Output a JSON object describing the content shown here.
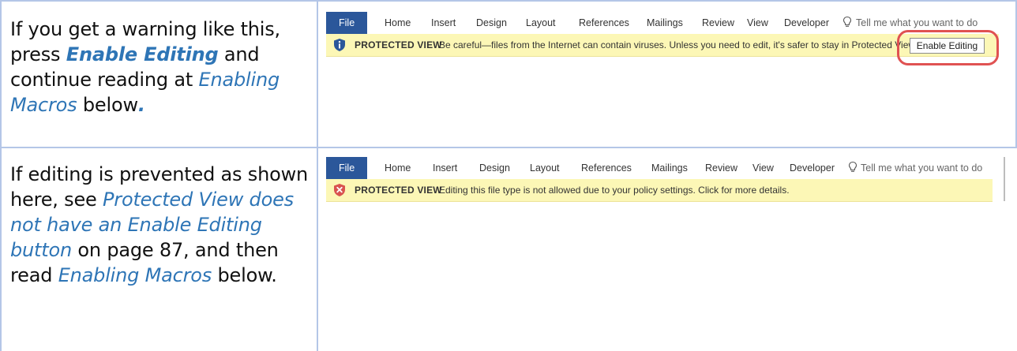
{
  "rows": [
    {
      "instruction": {
        "p1": "If you get a warning like this, press ",
        "bold_link": "Enable Editing",
        "p2": " and continue reading at ",
        "link": "Enabling Macros",
        "p3": " below",
        "p4": "."
      },
      "screenshot": {
        "tabs": [
          "File",
          "Home",
          "Insert",
          "Design",
          "Layout",
          "References",
          "Mailings",
          "Review",
          "View",
          "Developer"
        ],
        "tell_me": "Tell me what you want to do",
        "bar": {
          "icon": "info-shield-icon",
          "title": "PROTECTED VIEW",
          "message": "Be careful—files from the Internet can contain viruses. Unless you need to edit, it's safer to stay in Protected View.",
          "button": "Enable Editing",
          "color": "#fcf7b6"
        },
        "highlight_color": "#e05252"
      }
    },
    {
      "instruction": {
        "p1": "If editing is prevented as shown here, see ",
        "link": "Protected View does not have an Enable Editing button",
        "p2": " on page 87, and then read ",
        "link2": "Enabling Macros",
        "p3": " below."
      },
      "screenshot": {
        "tabs": [
          "File",
          "Home",
          "Insert",
          "Design",
          "Layout",
          "References",
          "Mailings",
          "Review",
          "View",
          "Developer"
        ],
        "tell_me": "Tell me what you want to do",
        "bar": {
          "icon": "error-shield-icon",
          "title": "PROTECTED VIEW",
          "message": "Editing this file type is not allowed due to your policy settings. Click for more details.",
          "color": "#fcf7b6"
        }
      }
    }
  ],
  "colors": {
    "file_tab": "#2b579a",
    "link": "#2e75b6",
    "table_border": "#b4c6e7"
  }
}
